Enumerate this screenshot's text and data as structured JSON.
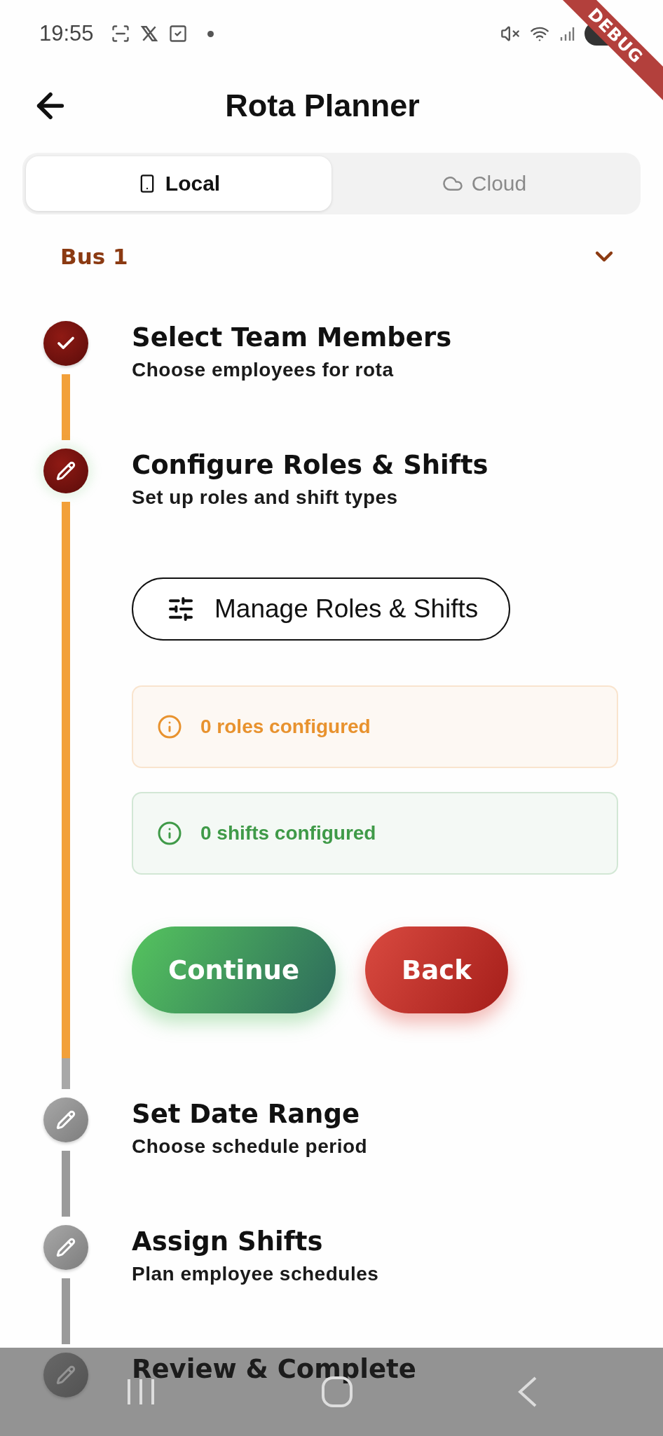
{
  "status_bar": {
    "time": "19:55"
  },
  "debug_banner": "DEBUG",
  "app_bar": {
    "title": "Rota Planner"
  },
  "storage_tabs": [
    {
      "label": "Local",
      "kind": "device",
      "selected": true
    },
    {
      "label": "Cloud",
      "kind": "cloud",
      "selected": false
    }
  ],
  "business_dropdown": {
    "value": "Bus 1"
  },
  "steps": [
    {
      "title": "Select Team Members",
      "subtitle": "Choose employees for rota",
      "completed": true,
      "current": false
    },
    {
      "title": "Configure Roles & Shifts",
      "subtitle": "Set up roles and shift types",
      "completed": false,
      "current": true,
      "content": {
        "manage_button": "Manage Roles & Shifts",
        "notices": [
          {
            "text": "0 roles configured",
            "color": "#e8922e"
          },
          {
            "text": "0 shifts configured",
            "color": "#3f9a48"
          }
        ],
        "buttons": [
          {
            "label": "Continue",
            "kind": "primary"
          },
          {
            "label": "Back",
            "kind": "secondary"
          }
        ]
      }
    },
    {
      "title": "Set Date Range",
      "subtitle": "Choose schedule period",
      "completed": false,
      "current": false
    },
    {
      "title": "Assign Shifts",
      "subtitle": "Plan employee schedules",
      "completed": false,
      "current": false
    },
    {
      "title": "Review & Complete",
      "completed": false,
      "current": false
    }
  ]
}
